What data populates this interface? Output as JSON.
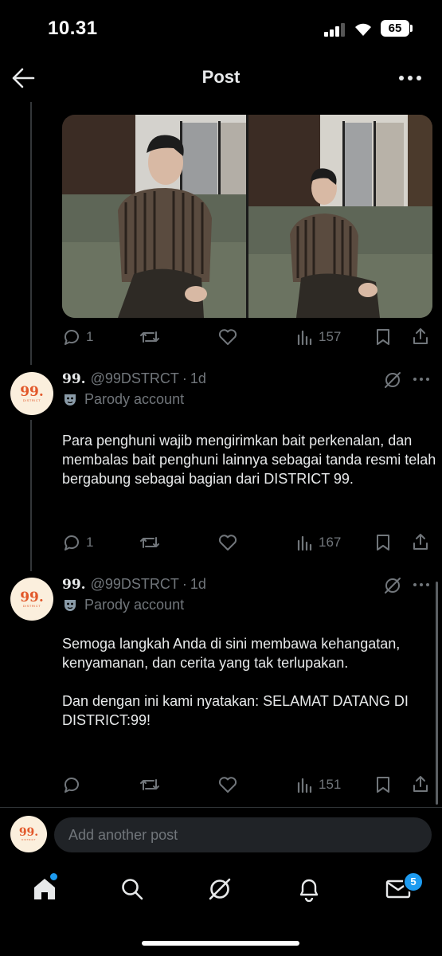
{
  "status_bar": {
    "time": "10.31",
    "battery": "65"
  },
  "header": {
    "title": "Post"
  },
  "media_post": {
    "replies": "1",
    "views": "157"
  },
  "posts": [
    {
      "name": "99.",
      "handle": "@99DSTRCT",
      "time": "1d",
      "label": "Parody account",
      "text": "Para penghuni wajib mengirimkan bait perkenalan, dan membalas bait penghuni lainnya sebagai tanda resmi telah bergabung sebagai bagian dari DISTRICT 99.",
      "replies": "1",
      "views": "167"
    },
    {
      "name": "99.",
      "handle": "@99DSTRCT",
      "time": "1d",
      "label": "Parody account",
      "text": "Semoga langkah Anda di sini membawa kehangatan, kenyamanan, dan cerita yang tak terlupakan.\n\nDan dengan ini kami nyatakan: SELAMAT DATANG DI DISTRICT:99!",
      "replies": "",
      "views": "151"
    }
  ],
  "avatar": {
    "mark": "99.",
    "sub": "DISTRICT"
  },
  "composer": {
    "placeholder": "Add another post"
  },
  "nav": {
    "messages_badge": "5"
  },
  "colors": {
    "background": "#000000",
    "text": "#e7e9ea",
    "muted": "#71767b",
    "accent": "#1d9bf0",
    "avatar_bg": "#fbefdd",
    "avatar_mark": "#e2582a"
  },
  "icons": [
    "back-arrow-icon",
    "more-icon",
    "reply-icon",
    "repost-icon",
    "like-icon",
    "views-icon",
    "bookmark-icon",
    "share-icon",
    "grok-icon",
    "parody-mask-icon",
    "home-icon",
    "search-icon",
    "notifications-icon",
    "messages-icon"
  ]
}
